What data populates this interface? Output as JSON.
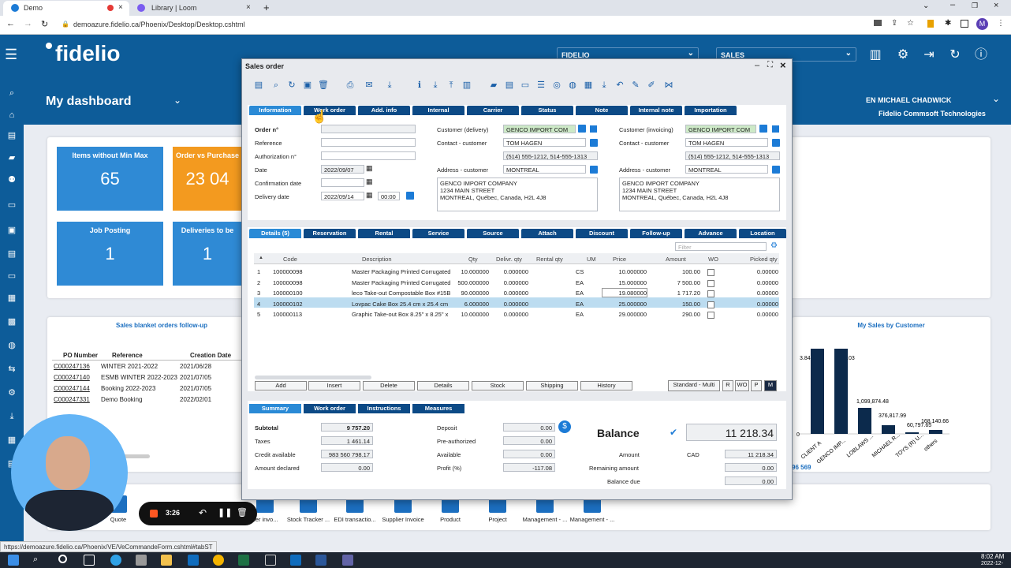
{
  "browser": {
    "tabs": [
      {
        "label": "Demo"
      },
      {
        "label": "Library | Loom"
      }
    ],
    "url": "demoazure.fidelio.ca/Phoenix/Desktop/Desktop.cshtml",
    "status_url": "https://demoazure.fidelio.ca/Phoenix/VE/VeCommandeForm.cshtml#tabST",
    "new_tab": "+",
    "avatar": "M"
  },
  "app": {
    "logo": "fidelio",
    "company_select": "FIDELIO",
    "module_select": "SALES",
    "dashboard_title": "My dashboard",
    "user": "EN MICHAEL CHADWICK",
    "company_name": "Fidelio Commsoft Technologies"
  },
  "tiles": [
    {
      "title": "Items without Min Max",
      "value": "65",
      "color": "#2f8ad5"
    },
    {
      "title": "Order vs Purchase",
      "value": "23 04",
      "color": "#f39a1f"
    },
    {
      "title": "Job Posting",
      "value": "1",
      "color": "#2f8ad5"
    },
    {
      "title": "Deliveries to be",
      "value": "1",
      "color": "#2f8ad5"
    }
  ],
  "blanket": {
    "title": "Sales blanket orders follow-up",
    "headers": [
      "PO Number",
      "Reference",
      "Creation Date"
    ],
    "rows": [
      {
        "po": "C000247136",
        "ref": "WINTER 2021-2022",
        "date": "2021/06/28"
      },
      {
        "po": "C000247140",
        "ref": "ESMB WINTER 2022-2023",
        "date": "2021/07/05"
      },
      {
        "po": "C000247144",
        "ref": "Booking 2022-2023",
        "date": "2021/07/05"
      },
      {
        "po": "C000247331",
        "ref": "Demo Booking",
        "date": "2022/02/01"
      }
    ]
  },
  "mysales": {
    "title": "My Sales by Customer",
    "labels": [
      "3.84",
      ".03",
      "1,099,874.48",
      "376,817.99",
      "60,797.65",
      "168,140.66"
    ],
    "categories": [
      "CLIENT A",
      "GENCO IMP...",
      "LOBLAWS ...",
      "MICHAEL R...",
      "TOYS (R) U...",
      "others"
    ],
    "axis0": "0",
    "footer": "96 569"
  },
  "bottom_tiles": [
    "Quote",
    "ner invo...",
    "Stock Tracker ...",
    "EDI transactio...",
    "Supplier Invoice",
    "Product",
    "Project",
    "Management - ...",
    "Management - ..."
  ],
  "loom": {
    "time": "3:26"
  },
  "window": {
    "title": "Sales order",
    "header_tabs": [
      "Information",
      "Work order",
      "Add. info",
      "Internal",
      "Carrier",
      "Status",
      "Note",
      "Internal note",
      "Importation"
    ],
    "fields": {
      "order_no_label": "Order n°",
      "reference_label": "Reference",
      "authorization_label": "Authorization n°",
      "date_label": "Date",
      "date_value": "2022/09/07",
      "confirmation_label": "Confirmation date",
      "delivery_label": "Delivery date",
      "delivery_value": "2022/09/14",
      "delivery_time": "00:00",
      "cust_delivery_label": "Customer (delivery)",
      "cust_delivery_value": "GENCO IMPORT COM",
      "contact_label": "Contact - customer",
      "contact_value": "TOM HAGEN",
      "phone_value": "(514) 555-1212, 514-555-1313",
      "address_label": "Address - customer",
      "address_value": "MONTREAL",
      "address_text": [
        "GENCO IMPORT COMPANY",
        "1234 MAIN STREET",
        "MONTREAL, Québec, Canada, H2L 4J8"
      ],
      "cust_invoicing_label": "Customer (invoicing)",
      "cust_invoicing_value": "GENCO IMPORT COM",
      "contact2_label": "Contact - customer",
      "contact2_value": "TOM HAGEN",
      "phone2_value": "(514) 555-1212, 514-555-1313",
      "address2_label": "Address - customer",
      "address2_value": "MONTREAL",
      "address2_text": [
        "GENCO IMPORT COMPANY",
        "1234 MAIN STREET",
        "MONTREAL, Québec, Canada, H2L 4J8"
      ]
    },
    "detail_tabs": [
      "Details (5)",
      "Reservation",
      "Rental",
      "Service",
      "Source",
      "Attach",
      "Discount",
      "Follow-up",
      "Advance invoicing",
      "Location"
    ],
    "filter_placeholder": "Filter",
    "grid_headers": [
      "Code",
      "Description",
      "Qty",
      "Delivr. qty",
      "Rental qty",
      "UM",
      "Price",
      "Amount",
      "WO",
      "Picked qty"
    ],
    "rows": [
      {
        "n": "1",
        "code": "100000098",
        "desc": "Master Packaging Printed Corrugated",
        "qty": "10.000000",
        "dqty": "0.000000",
        "um": "CS",
        "price": "10.000000",
        "amount": "100.00",
        "picked": "0.00000"
      },
      {
        "n": "2",
        "code": "100000098",
        "desc": "Master Packaging Printed Corrugated",
        "qty": "500.000000",
        "dqty": "0.000000",
        "um": "EA",
        "price": "15.000000",
        "amount": "7 500.00",
        "picked": "0.00000"
      },
      {
        "n": "3",
        "code": "100000100",
        "desc": "leco Take-out Compostable Box #15B",
        "qty": "90.000000",
        "dqty": "0.000000",
        "um": "EA",
        "price": "19.080000",
        "amount": "1 717.20",
        "picked": "0.00000"
      },
      {
        "n": "4",
        "code": "100000102",
        "desc": "Lovpac Cake Box 25.4 cm x 25.4 cm",
        "qty": "6.000000",
        "dqty": "0.000000",
        "um": "EA",
        "price": "25.000000",
        "amount": "150.00",
        "picked": "0.00000"
      },
      {
        "n": "5",
        "code": "100000113",
        "desc": "Graphic Take-out Box 8.25\" x 8.25\" x",
        "qty": "10.000000",
        "dqty": "0.000000",
        "um": "EA",
        "price": "29.000000",
        "amount": "290.00",
        "picked": "0.00000"
      }
    ],
    "grid_buttons": [
      "Add",
      "Insert",
      "Delete",
      "Details",
      "Stock",
      "Shipping",
      "History"
    ],
    "mode_buttons": [
      "Standard - Multi",
      "R",
      "WO",
      "P",
      "M"
    ],
    "summary_tabs": [
      "Summary",
      "Work order",
      "Instructions",
      "Measures"
    ],
    "summary": {
      "subtotal_label": "Subtotal",
      "subtotal": "9 757.20",
      "taxes_label": "Taxes",
      "taxes": "1 461.14",
      "credit_label": "Credit available",
      "credit": "983 560 798.17",
      "declared_label": "Amount declared",
      "declared": "0.00",
      "deposit_label": "Deposit",
      "deposit": "0.00",
      "preauth_label": "Pre-authorized",
      "preauth": "0.00",
      "available_label": "Available",
      "available": "0.00",
      "profit_label": "Profit (%)",
      "profit": "-117.08",
      "balance_label": "Balance",
      "balance": "11 218.34",
      "amount_label": "Amount",
      "currency": "CAD",
      "amount": "11 218.34",
      "remaining_label": "Remaining amount",
      "remaining": "0.00",
      "due_label": "Balance due",
      "due": "0.00"
    }
  },
  "taskbar": {
    "time": "8:02 AM",
    "date": "2022-12-"
  }
}
